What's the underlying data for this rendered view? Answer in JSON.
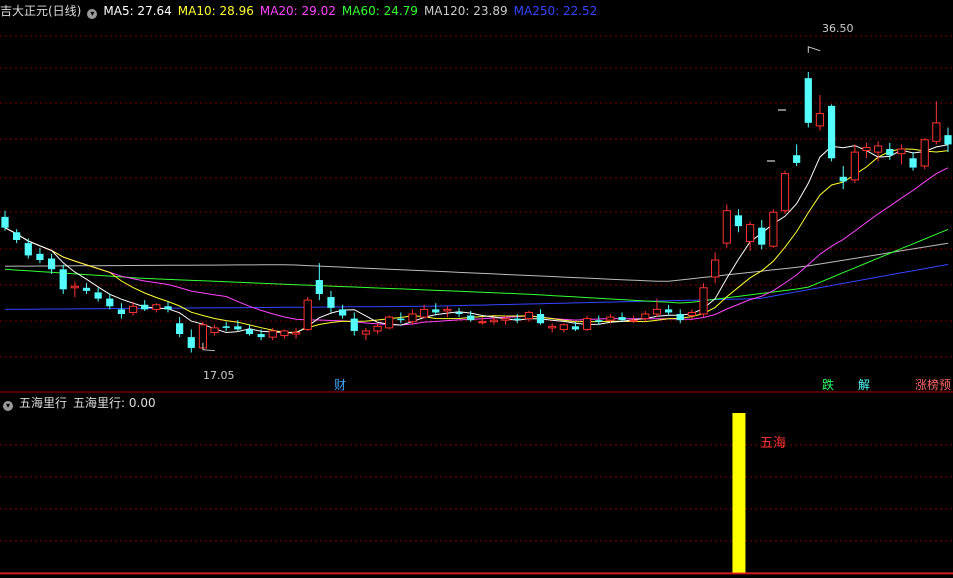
{
  "header": {
    "title": "吉大正元(日线)",
    "ma": [
      {
        "label": "MA5: 27.64",
        "color": "#ffffff"
      },
      {
        "label": "MA10: 28.96",
        "color": "#ffff33"
      },
      {
        "label": "MA20: 29.02",
        "color": "#ff33ff"
      },
      {
        "label": "MA60: 24.79",
        "color": "#33ff33"
      },
      {
        "label": "MA120: 23.89",
        "color": "#cccccc"
      },
      {
        "label": "MA250: 22.52",
        "color": "#3333ff"
      }
    ]
  },
  "indicator": {
    "title": "五海里行",
    "value_label": "五海里行: 0.00",
    "bar_label": "五海"
  },
  "markers": {
    "high": "36.50",
    "low": "17.05",
    "cai": "财",
    "die": "跌",
    "jie": "解",
    "zhang": "涨榜预"
  },
  "colors": {
    "up": "#ff3232",
    "down": "#54ffff",
    "grid": "#7a0000",
    "indicator_bar": "#ffff00"
  },
  "chart_data": {
    "type": "candlestick",
    "ohlc": [
      [
        25.6,
        26.0,
        24.7,
        24.9
      ],
      [
        24.6,
        24.8,
        23.9,
        24.1
      ],
      [
        23.9,
        24.2,
        22.9,
        23.1
      ],
      [
        23.2,
        23.6,
        22.6,
        22.8
      ],
      [
        22.9,
        23.2,
        21.9,
        22.2
      ],
      [
        22.2,
        22.5,
        20.6,
        20.9
      ],
      [
        21.0,
        21.4,
        20.4,
        21.1
      ],
      [
        21.0,
        21.3,
        20.6,
        20.8
      ],
      [
        20.7,
        21.0,
        20.1,
        20.3
      ],
      [
        20.3,
        20.6,
        19.6,
        19.8
      ],
      [
        19.6,
        20.0,
        19.0,
        19.3
      ],
      [
        19.4,
        20.1,
        19.2,
        19.8
      ],
      [
        19.9,
        20.2,
        19.5,
        19.6
      ],
      [
        19.6,
        20.0,
        19.4,
        19.9
      ],
      [
        19.8,
        20.1,
        19.4,
        19.6
      ],
      [
        18.7,
        19.1,
        17.8,
        18.0
      ],
      [
        17.8,
        18.3,
        16.8,
        17.1
      ],
      [
        17.1,
        18.8,
        17.0,
        18.6
      ],
      [
        18.1,
        18.6,
        17.9,
        18.4
      ],
      [
        18.5,
        18.8,
        18.2,
        18.4
      ],
      [
        18.5,
        18.9,
        18.2,
        18.3
      ],
      [
        18.3,
        18.6,
        17.9,
        18.0
      ],
      [
        18.0,
        18.3,
        17.6,
        17.8
      ],
      [
        17.8,
        18.4,
        17.6,
        18.2
      ],
      [
        17.9,
        18.3,
        17.7,
        18.2
      ],
      [
        18.0,
        18.4,
        17.7,
        18.1
      ],
      [
        18.3,
        20.4,
        18.2,
        20.2
      ],
      [
        21.5,
        22.6,
        20.2,
        20.6
      ],
      [
        20.4,
        20.8,
        19.4,
        19.7
      ],
      [
        19.6,
        19.9,
        19.0,
        19.2
      ],
      [
        19.0,
        19.4,
        17.9,
        18.2
      ],
      [
        18.0,
        18.4,
        17.6,
        18.2
      ],
      [
        18.2,
        18.7,
        18.0,
        18.5
      ],
      [
        18.4,
        19.2,
        18.3,
        19.1
      ],
      [
        19.0,
        19.4,
        18.7,
        18.9
      ],
      [
        18.8,
        19.6,
        18.6,
        19.3
      ],
      [
        19.1,
        19.9,
        19.0,
        19.6
      ],
      [
        19.6,
        20.0,
        19.2,
        19.4
      ],
      [
        19.5,
        19.8,
        19.1,
        19.6
      ],
      [
        19.4,
        19.7,
        19.1,
        19.3
      ],
      [
        19.2,
        19.5,
        18.8,
        18.9
      ],
      [
        18.8,
        19.1,
        18.6,
        18.8
      ],
      [
        18.8,
        19.1,
        18.6,
        18.9
      ],
      [
        18.9,
        19.2,
        18.6,
        19.0
      ],
      [
        19.0,
        19.3,
        18.7,
        18.9
      ],
      [
        19.0,
        19.5,
        18.8,
        19.4
      ],
      [
        19.3,
        19.6,
        18.6,
        18.7
      ],
      [
        18.4,
        18.7,
        18.1,
        18.5
      ],
      [
        18.3,
        18.7,
        18.1,
        18.6
      ],
      [
        18.5,
        18.8,
        18.2,
        18.3
      ],
      [
        18.3,
        19.2,
        18.2,
        19.0
      ],
      [
        18.9,
        19.2,
        18.6,
        18.8
      ],
      [
        18.9,
        19.3,
        18.7,
        19.1
      ],
      [
        19.1,
        19.4,
        18.8,
        18.9
      ],
      [
        18.9,
        19.2,
        18.7,
        18.9
      ],
      [
        19.0,
        19.5,
        18.8,
        19.3
      ],
      [
        19.3,
        20.3,
        19.1,
        19.6
      ],
      [
        19.6,
        19.9,
        19.2,
        19.4
      ],
      [
        19.3,
        19.6,
        18.7,
        18.9
      ],
      [
        19.2,
        19.6,
        19.0,
        19.4
      ],
      [
        19.3,
        21.3,
        19.1,
        21.0
      ],
      [
        21.7,
        23.3,
        21.3,
        22.8
      ],
      [
        23.9,
        26.4,
        23.6,
        26.0
      ],
      [
        25.7,
        26.1,
        24.6,
        25.0
      ],
      [
        24.0,
        25.3,
        23.4,
        25.1
      ],
      [
        24.9,
        25.4,
        23.5,
        23.8
      ],
      [
        23.7,
        26.1,
        23.6,
        25.9
      ],
      [
        26.0,
        28.6,
        25.8,
        28.4
      ],
      [
        29.6,
        30.3,
        28.9,
        29.1
      ],
      [
        34.6,
        35.0,
        31.4,
        31.7
      ],
      [
        31.5,
        33.5,
        31.2,
        32.3
      ],
      [
        32.8,
        32.9,
        29.2,
        29.4
      ],
      [
        28.2,
        28.9,
        27.4,
        27.9
      ],
      [
        28.0,
        30.3,
        27.8,
        29.8
      ],
      [
        29.9,
        30.4,
        29.4,
        30.1
      ],
      [
        29.8,
        30.5,
        29.2,
        30.2
      ],
      [
        30.0,
        30.4,
        29.3,
        29.6
      ],
      [
        29.7,
        30.3,
        29.0,
        30.0
      ],
      [
        29.4,
        29.8,
        28.6,
        28.8
      ],
      [
        28.9,
        30.7,
        28.7,
        30.6
      ],
      [
        30.5,
        33.1,
        30.3,
        31.7
      ],
      [
        30.9,
        31.4,
        29.8,
        30.3
      ]
    ],
    "ma5_end": 27.64,
    "ma10_end": 28.96,
    "ma20_end": 29.02,
    "ma60_end": 24.79,
    "ma120_end": 23.89,
    "ma250_end": 22.52,
    "high_marker": 36.5,
    "low_marker": 17.05,
    "indicator_series_nonzero_index": 63,
    "indicator_value": 0.0
  }
}
